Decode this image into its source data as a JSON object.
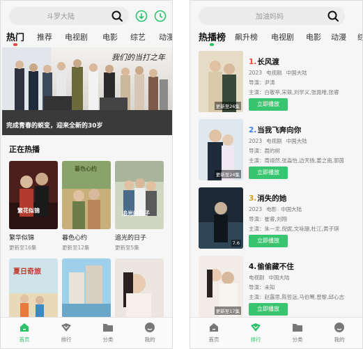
{
  "colors": {
    "accent": "#2bc26a",
    "tab_dot_left": "#e74c3c",
    "tab_dot_right": "#2bc26a",
    "button_green": "#39c46f"
  },
  "left": {
    "search": {
      "placeholder": "斗罗大陆",
      "icon": "search-icon"
    },
    "top_icons": [
      "download-icon",
      "history-icon"
    ],
    "tabs": [
      "热门",
      "推荐",
      "电视剧",
      "电影",
      "综艺",
      "动漫"
    ],
    "active_tab": "热门",
    "banner": {
      "caption": "完成青春的蜕变，迎来全新的30岁",
      "title_art": "我们的当打之年"
    },
    "section_title": "正在热播",
    "cards": [
      {
        "title": "繁华似锦",
        "sub": "更新至16集",
        "poster_text": "繁花似锦"
      },
      {
        "title": "暮色心约",
        "sub": "更新至12集",
        "poster_text": "暮色心约"
      },
      {
        "title": "追光的日子",
        "sub": "更新至5集",
        "poster_text": "追光的日子"
      }
    ],
    "cards_row2_poster_text": [
      "夏日奇旅",
      "",
      ""
    ],
    "nav": [
      {
        "label": "首页",
        "icon": "home-icon",
        "active": true
      },
      {
        "label": "排行",
        "icon": "rank-icon",
        "active": false
      },
      {
        "label": "分类",
        "icon": "folder-icon",
        "active": false
      },
      {
        "label": "我的",
        "icon": "user-icon",
        "active": false
      }
    ]
  },
  "right": {
    "search": {
      "placeholder": "加油妈妈",
      "icon": "search-icon"
    },
    "tabs": [
      "热播榜",
      "飙升榜",
      "电视剧",
      "电影",
      "动漫",
      "综"
    ],
    "active_tab": "热播榜",
    "ranks": [
      {
        "num": "1.",
        "title": "长风渡",
        "year": "2023",
        "type": "电视剧",
        "region": "中国大陆",
        "director": "导演：尹涛",
        "cast": "主演：白敬亭,宋轶,刘学义,张晁唯,张睿",
        "update": "更新至26集",
        "button": "立即播放",
        "num_color": "#e74c3c"
      },
      {
        "num": "2.",
        "title": "当我飞奔向你",
        "year": "2023",
        "type": "电视剧",
        "region": "中国大陆",
        "director": "导演：聂的树",
        "cast": "主演：周翊然,张淼怡,边天扬,姜之南,郭茵",
        "update": "更新至24集",
        "button": "立即播放",
        "num_color": "#3b82f6"
      },
      {
        "num": "3.",
        "title": "消失的她",
        "year": "2023",
        "type": "电影",
        "region": "中国大陆",
        "director": "导演：崔睿,刘翔",
        "cast": "主演：朱一龙,倪妮,文咏珊,杜江,黄子琪",
        "update": "7.6",
        "button": "立即播放",
        "num_color": "#d4a017"
      },
      {
        "num": "4.",
        "title": "偷偷藏不住",
        "year": "",
        "type": "电视剧",
        "region": "中国大陆",
        "director": "导演：未知",
        "cast": "主演：赵露思,陈哲远,马伯骞,曾黎,邱心志",
        "update": "更新至17集",
        "button": "立即播放",
        "num_color": "#111111"
      }
    ],
    "nav": [
      {
        "label": "首页",
        "icon": "home-icon",
        "active": false
      },
      {
        "label": "排行",
        "icon": "rank-icon",
        "active": true
      },
      {
        "label": "分类",
        "icon": "folder-icon",
        "active": false
      },
      {
        "label": "我的",
        "icon": "user-icon",
        "active": false
      }
    ]
  }
}
